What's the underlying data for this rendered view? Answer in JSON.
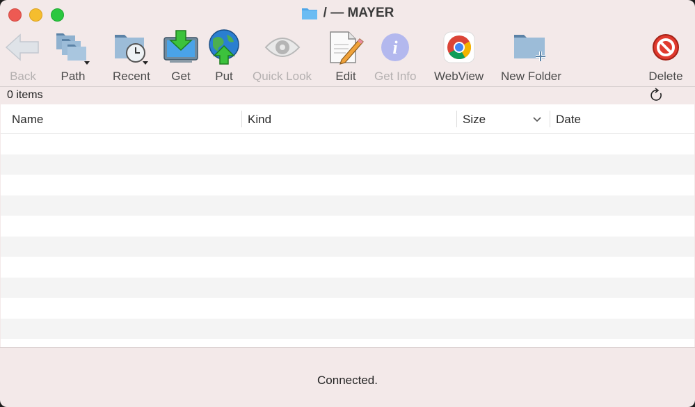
{
  "window": {
    "title": "/ — MAYER"
  },
  "toolbar": {
    "back": "Back",
    "path": "Path",
    "recent": "Recent",
    "get": "Get",
    "put": "Put",
    "quick_look": "Quick Look",
    "edit": "Edit",
    "get_info": "Get Info",
    "webview": "WebView",
    "new_folder": "New Folder",
    "delete": "Delete"
  },
  "status": {
    "items_count": "0 items"
  },
  "table": {
    "columns": [
      "Name",
      "Kind",
      "Size",
      "Date"
    ],
    "rows": []
  },
  "footer": {
    "status_text": "Connected."
  },
  "colors": {
    "window_bg": "#f3e9e9",
    "accent_blue": "#5aa9e6",
    "close": "#ed5a53",
    "minimize": "#f5bd2e",
    "zoom": "#2ac73f"
  }
}
